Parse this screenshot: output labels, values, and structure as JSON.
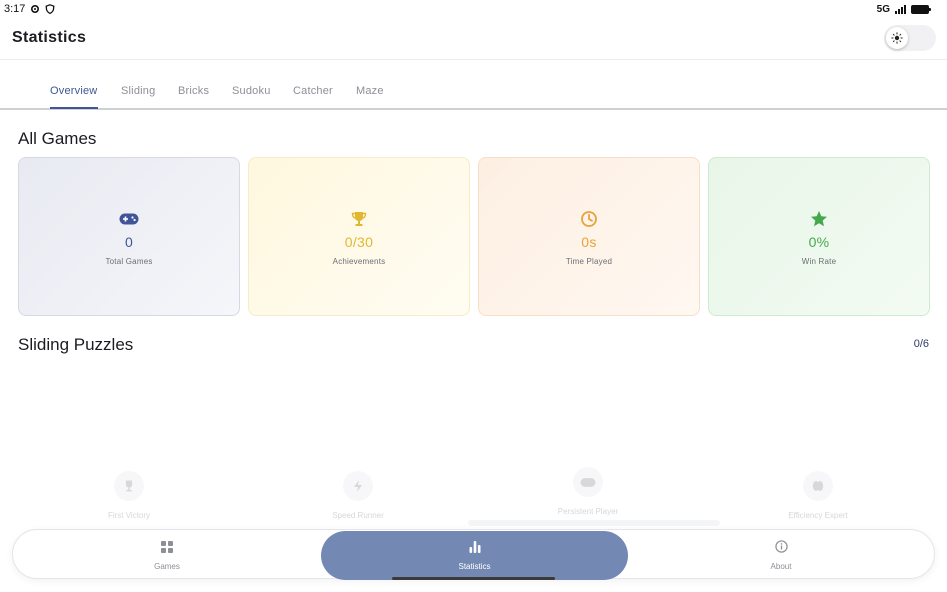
{
  "status_bar": {
    "time": "3:17",
    "network": "5G"
  },
  "app_bar": {
    "title": "Statistics"
  },
  "tabs": [
    {
      "label": "Overview",
      "active": true
    },
    {
      "label": "Sliding"
    },
    {
      "label": "Bricks"
    },
    {
      "label": "Sudoku"
    },
    {
      "label": "Catcher"
    },
    {
      "label": "Maze"
    }
  ],
  "all_games": {
    "title": "All Games",
    "cards": [
      {
        "icon": "gamepad-icon",
        "value": "0",
        "label": "Total Games",
        "color": "#3f5597"
      },
      {
        "icon": "trophy-icon",
        "value": "0/30",
        "label": "Achievements",
        "color": "#e0b830"
      },
      {
        "icon": "clock-icon",
        "value": "0s",
        "label": "Time Played",
        "color": "#e8a23a"
      },
      {
        "icon": "star-icon",
        "value": "0%",
        "label": "Win Rate",
        "color": "#45a84c"
      }
    ]
  },
  "sliding_puzzles": {
    "title": "Sliding Puzzles",
    "count": "0/6",
    "achievements": [
      {
        "icon": "trophy-icon",
        "name": "First Victory"
      },
      {
        "icon": "bolt-icon",
        "name": "Speed Runner"
      },
      {
        "icon": "gamepad-icon",
        "name": "Persistent Player"
      },
      {
        "icon": "brain-icon",
        "name": "Efficiency Expert"
      }
    ]
  },
  "bottom_nav": [
    {
      "icon": "grid-icon",
      "label": "Games"
    },
    {
      "icon": "bar-chart-icon",
      "label": "Statistics",
      "active": true
    },
    {
      "icon": "info-icon",
      "label": "About"
    }
  ]
}
